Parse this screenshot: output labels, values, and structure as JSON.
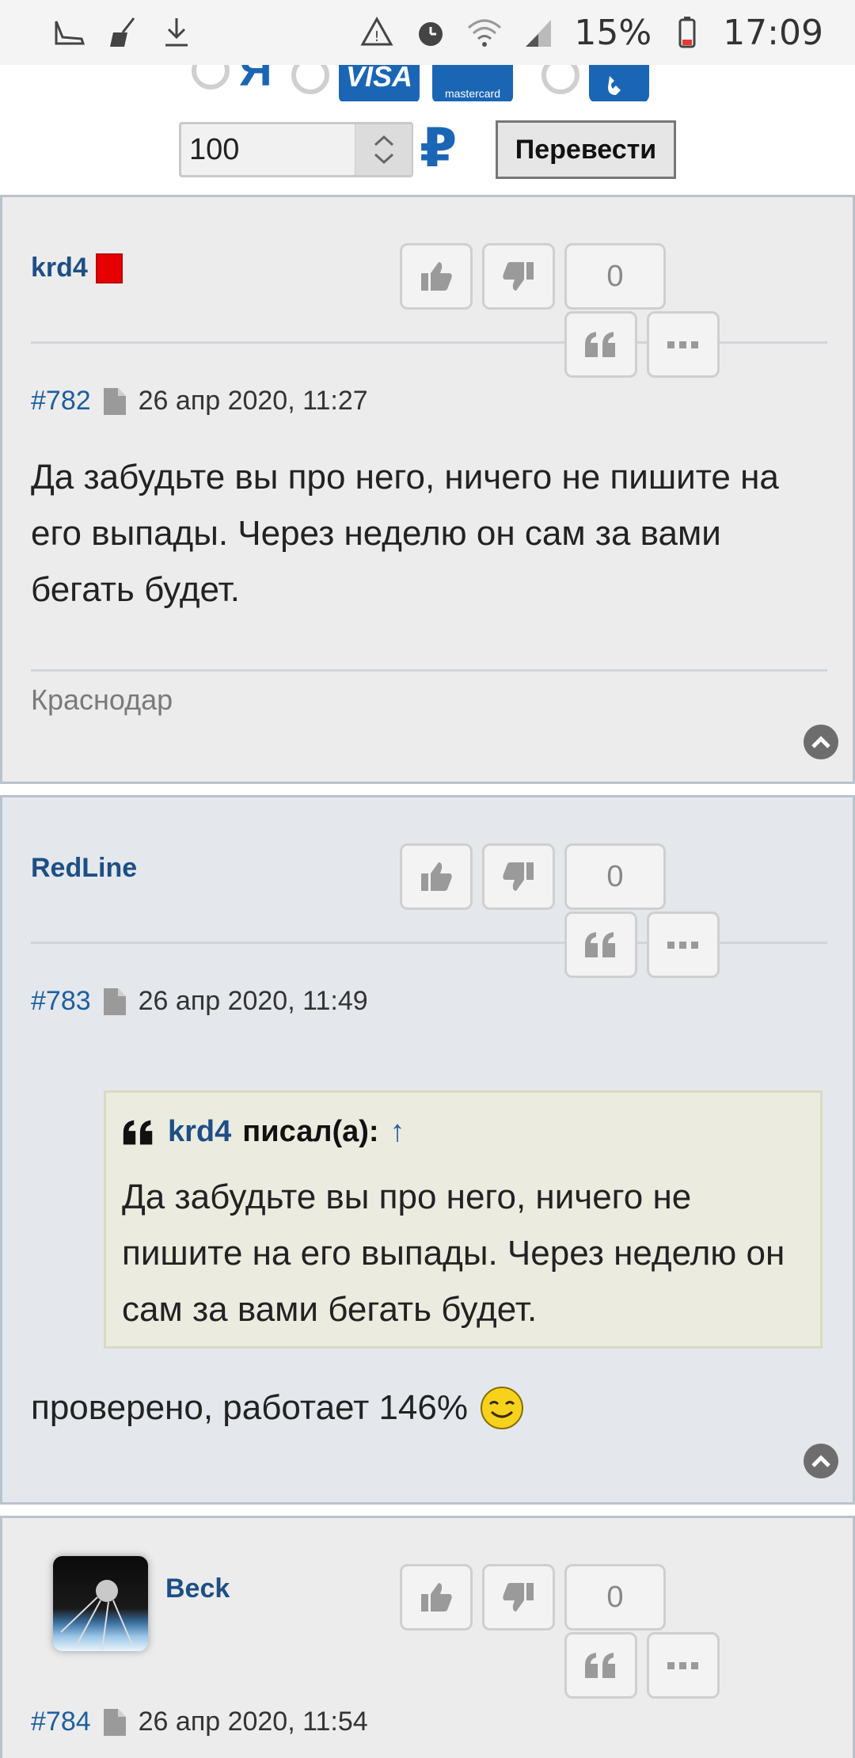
{
  "status_bar": {
    "left_icons": [
      "shoe-icon",
      "broom-icon",
      "download-icon"
    ],
    "right_icons": [
      "recycle-alert-icon",
      "alarm-icon",
      "wifi-icon",
      "signal-icon"
    ],
    "battery": "15%",
    "time": "17:09"
  },
  "payment": {
    "ya_label": "Я",
    "visa_label": "VISA",
    "mastercard_label": "mastercard"
  },
  "amount": {
    "value": "100",
    "currency": "₽",
    "convert_label": "Перевести"
  },
  "posts": [
    {
      "author": "krd4",
      "score": "0",
      "number": "#782",
      "date": "26 апр 2020, 11:27",
      "body": "Да забудьте вы про него, ничего не пишите на его выпады. Через неделю он сам за вами бегать будет.",
      "location": "Краснодар"
    },
    {
      "author": "RedLine",
      "score": "0",
      "number": "#783",
      "date": "26 апр 2020, 11:49",
      "quote_author": "krd4",
      "quote_wrote": "писал(а):",
      "quote_arrow": "↑",
      "quote_text": "Да забудьте вы про него, ничего не пишите на его выпады. Через неделю он сам за вами бегать будет.",
      "body": "проверено, работает 146%"
    },
    {
      "author": "Beck",
      "score": "0",
      "number": "#784",
      "date": "26 апр 2020, 11:54"
    }
  ],
  "colors": {
    "accent": "#1a66b5",
    "link": "#1d5fa0",
    "status_red": "#e60000"
  }
}
